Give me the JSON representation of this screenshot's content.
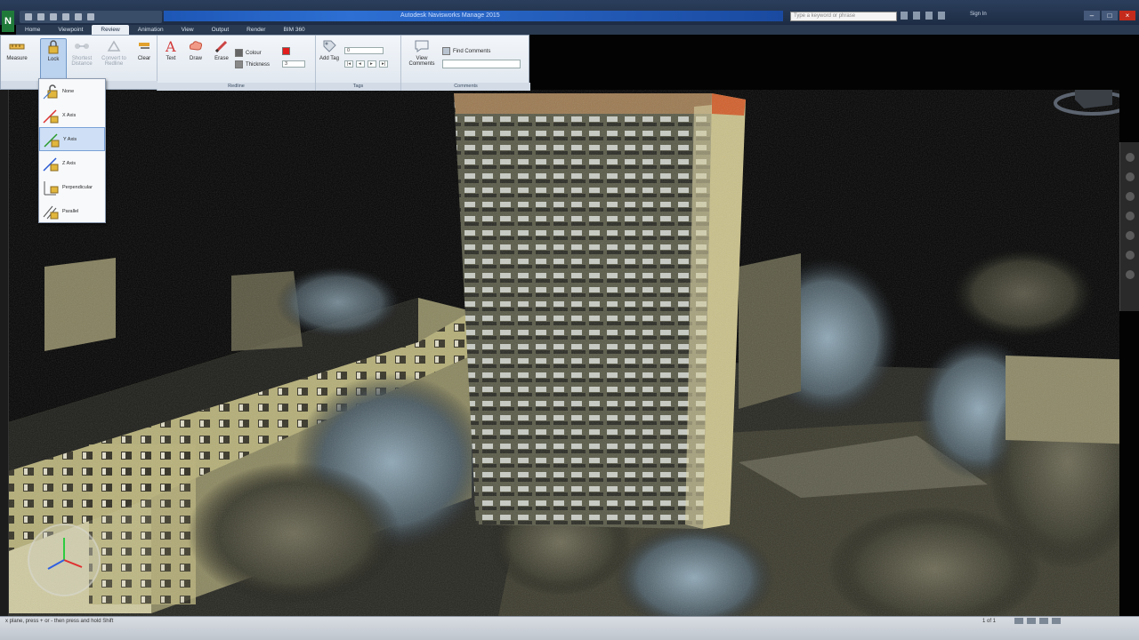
{
  "app": {
    "logo_letter": "N",
    "title": "Autodesk Navisworks Manage 2015",
    "search_placeholder": "Type a keyword or phrase",
    "sign_in": "Sign In"
  },
  "tabs": [
    {
      "label": "Home"
    },
    {
      "label": "Viewpoint"
    },
    {
      "label": "Review"
    },
    {
      "label": "Animation"
    },
    {
      "label": "View"
    },
    {
      "label": "Output"
    },
    {
      "label": "Render"
    },
    {
      "label": "BIM 360"
    }
  ],
  "active_tab": "Review",
  "ribbon": {
    "measure_label": "Measure",
    "lock_label": "Lock",
    "measure_to_label": "Shortest Distance",
    "convert_label": "Convert to Redline",
    "clear_label": "Clear",
    "text_label": "Text",
    "draw_label": "Draw",
    "erase_label": "Erase",
    "color_label": "Colour",
    "thickness_label": "Thickness",
    "thickness_value": "3",
    "redline_panel": "Redline",
    "add_tag_label": "Add Tag",
    "tag_value": "0",
    "tags_panel": "Tags",
    "view_comments_label": "View Comments",
    "find_comments_label": "Find Comments",
    "comments_panel": "Comments"
  },
  "lock_menu": [
    {
      "label": "None"
    },
    {
      "label": "X Axis"
    },
    {
      "label": "Y Axis"
    },
    {
      "label": "Z Axis"
    },
    {
      "label": "Perpendicular"
    },
    {
      "label": "Parallel"
    }
  ],
  "status": {
    "hint": "x plane, press + or - then press and hold Shift",
    "page": "1 of 1"
  },
  "colors": {
    "title_bar": "#1d2c44",
    "ribbon": "#e5ebf2",
    "accent": "#2d6fd3",
    "redline": "#e21b1b"
  }
}
